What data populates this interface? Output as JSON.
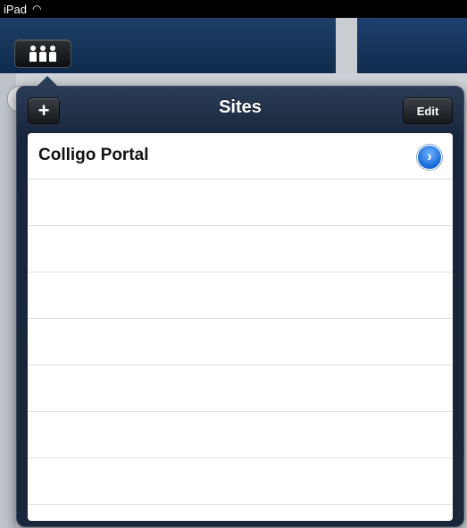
{
  "status": {
    "device": "iPad",
    "wifi_icon": "wifi-icon"
  },
  "toolbar": {
    "people_icon": "people-icon"
  },
  "popover": {
    "title": "Sites",
    "add_label": "+",
    "edit_label": "Edit",
    "sites": [
      {
        "name": "Colligo Portal",
        "action_icon": "chevron-right-icon"
      }
    ],
    "empty_rows": 7
  },
  "colors": {
    "navbar": "#1d3f67",
    "popover": "#17253a",
    "accent": "#1667d6"
  }
}
